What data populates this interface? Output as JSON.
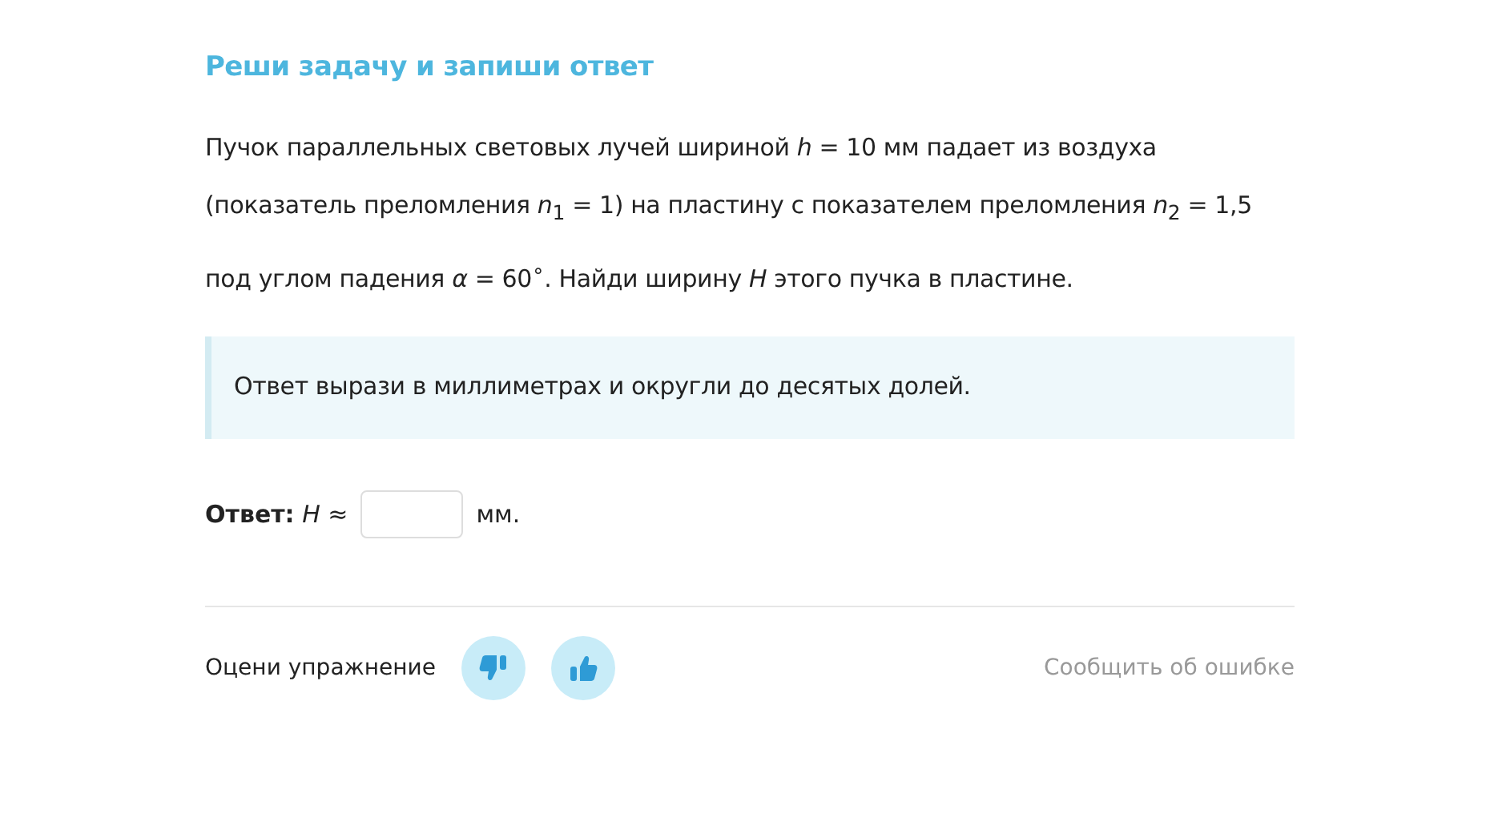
{
  "title": "Реши задачу и запиши ответ",
  "problem": "Пучок параллельных световых лучей шириной *h* = 10 мм падает из воздуха (показатель преломления *n*$_{1}$ = 1) на пластину с показателем преломления *n*$_{2}$ = 1,5 под углом падения *α* = 60$^{∘}$. Найди ширину *H* этого пучка в пластине.",
  "hint": "Ответ вырази в миллиметрах и округли до десятых долей.",
  "answer": {
    "label": "**Ответ:** *H* ≈",
    "unit": "мм."
  },
  "footer": {
    "rate_label": "Оцени упражнение",
    "report_link": "Сообщить об ошибке"
  }
}
